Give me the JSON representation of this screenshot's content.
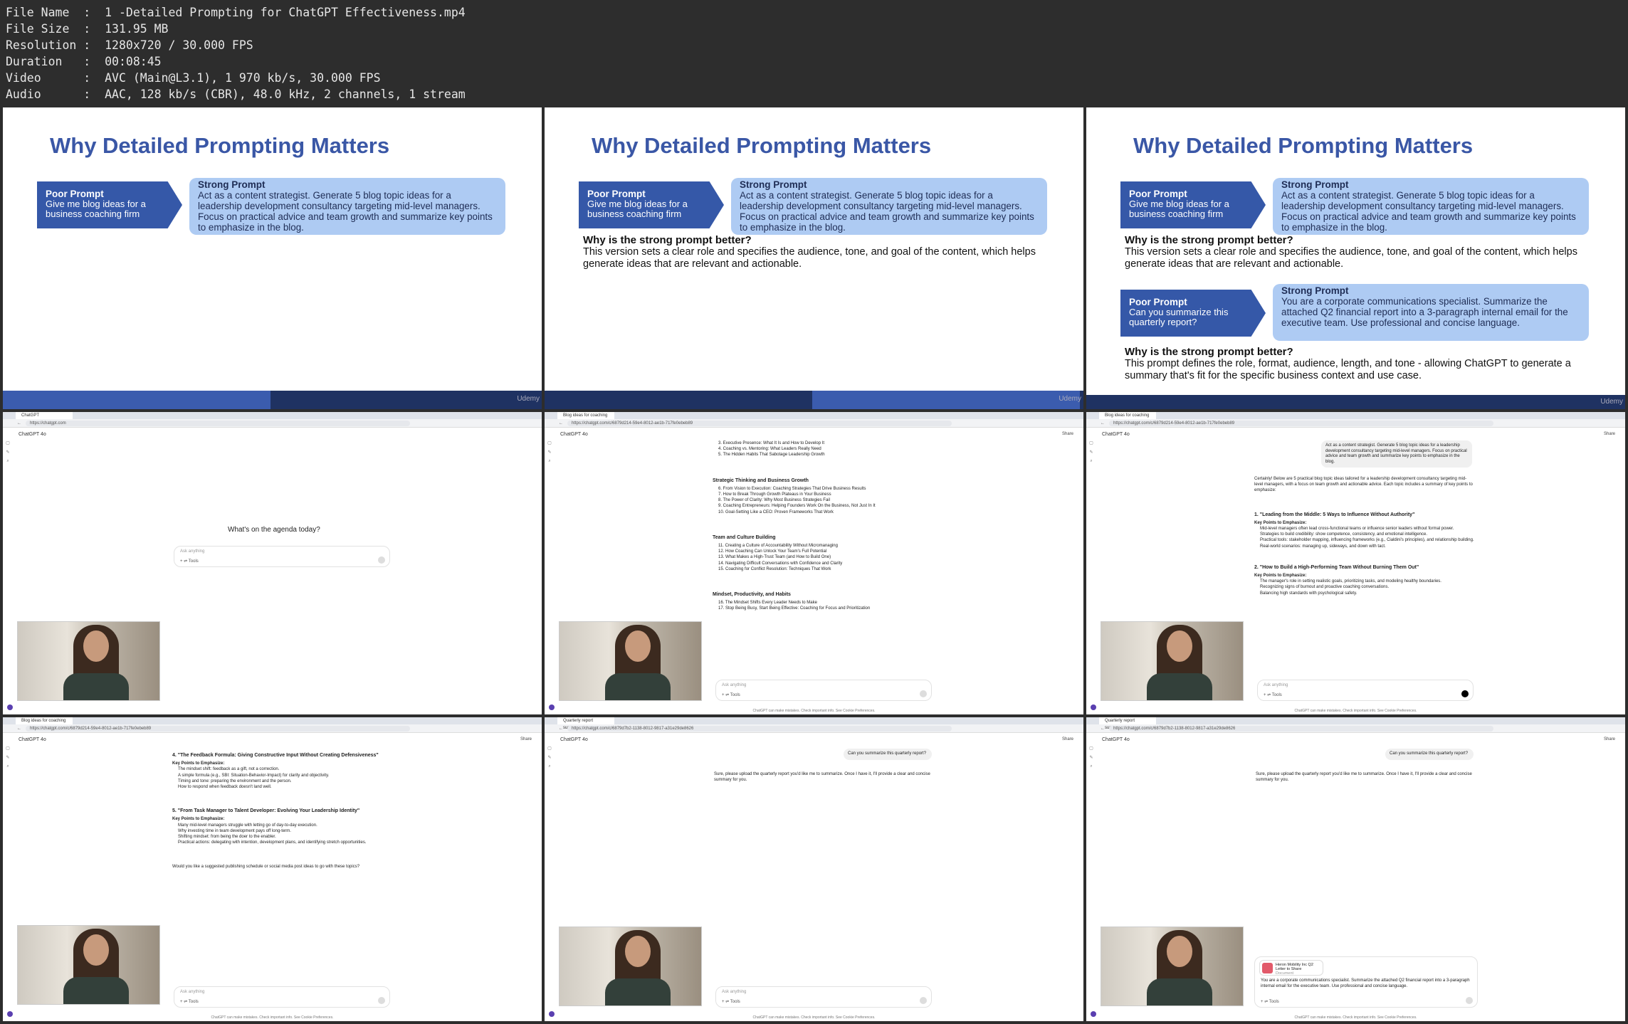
{
  "file_info": {
    "rows": [
      {
        "label": "File Name",
        "value": "1 -Detailed Prompting for ChatGPT Effectiveness.mp4"
      },
      {
        "label": "File Size",
        "value": "131.95 MB"
      },
      {
        "label": "Resolution",
        "value": "1280x720 / 30.000 FPS"
      },
      {
        "label": "Duration",
        "value": "00:08:45"
      },
      {
        "label": "Video",
        "value": "AVC (Main@L3.1), 1 970 kb/s, 30.000 FPS"
      },
      {
        "label": "Audio",
        "value": "AAC, 128 kb/s (CBR), 48.0 kHz, 2 channels, 1 stream"
      }
    ]
  },
  "slide": {
    "title": "Why Detailed Prompting Matters",
    "poor1_label": "Poor Prompt",
    "poor1_text": "Give me blog ideas for a business coaching firm",
    "strong1_label": "Strong Prompt",
    "strong1_text": "Act as a content strategist. Generate 5 blog topic ideas for a leadership development consultancy targeting mid-level managers. Focus on practical advice and team growth and summarize key points to emphasize in the blog.",
    "why1_q": "Why is the strong prompt better?",
    "why1_a": "This version sets a clear role and specifies the audience, tone, and goal of the content, which helps generate ideas that are relevant and actionable.",
    "poor2_label": "Poor Prompt",
    "poor2_text": "Can you summarize this quarterly report?",
    "strong2_label": "Strong Prompt",
    "strong2_text": "You are a corporate communications specialist. Summarize the attached Q2 financial report into a 3-paragraph internal email for the executive team. Use professional and concise language.",
    "why2_q": "Why is the strong prompt better?",
    "why2_a": "This prompt defines the role, format, audience, length, and tone - allowing ChatGPT to generate a summary that's fit for the specific business context and use case.",
    "logo": "Udemy"
  },
  "screens": {
    "gpt_label": "ChatGPT 4o",
    "share": "Share",
    "placeholder": "Ask anything",
    "tools": "Tools",
    "footer": "ChatGPT can make mistakes. Check important info. See Cookie Preferences.",
    "s1_tab": "ChatGPT",
    "s1_url": "https://chatgpt.com",
    "s1_heading": "What's on the agenda today?",
    "s2_tab": "Blog ideas for coaching",
    "s2_url": "https://chatgpt.com/c/6879d214-59e4-8012-ae1b-717fe0ebeb89",
    "s2_lines_top": [
      "3.  Executive Presence: What It Is and How to Develop It",
      "4.  Coaching vs. Mentoring: What Leaders Really Need",
      "5.  The Hidden Habits That Sabotage Leadership Growth"
    ],
    "s2_h1": "Strategic Thinking and Business Growth",
    "s2_l1": [
      "6.  From Vision to Execution: Coaching Strategies That Drive Business Results",
      "7.  How to Break Through Growth Plateaus in Your Business",
      "8.  The Power of Clarity: Why Most Business Strategies Fail",
      "9.  Coaching Entrepreneurs: Helping Founders Work On the Business, Not Just In It",
      "10.  Goal-Setting Like a CEO: Proven Frameworks That Work"
    ],
    "s2_h2": "Team and Culture Building",
    "s2_l2": [
      "11.  Creating a Culture of Accountability Without Micromanaging",
      "12.  How Coaching Can Unlock Your Team's Full Potential",
      "13.  What Makes a High-Trust Team (and How to Build One)",
      "14.  Navigating Difficult Conversations with Confidence and Clarity",
      "15.  Coaching for Conflict Resolution: Techniques That Work"
    ],
    "s2_h3": "Mindset, Productivity, and Habits",
    "s2_l3": [
      "16.  The Mindset Shifts Every Leader Needs to Make",
      "17.  Stop Being Busy, Start Being Effective: Coaching for Focus and Prioritization"
    ],
    "s3_user": "Act as a content strategist. Generate 5 blog topic ideas for a leadership development consultancy targeting mid-level managers. Focus on practical advice and team growth and summarize key points to emphasize in the blog.",
    "s3_intro": "Certainly! Below are 5 practical blog topic ideas tailored for a leadership development consultancy targeting mid-level managers, with a focus on team growth and actionable advice. Each topic includes a summary of key points to emphasize:",
    "s3_h1": "1. \"Leading from the Middle: 5 Ways to Influence Without Authority\"",
    "s3_kp": "Key Points to Emphasize:",
    "s3_b1": [
      "Mid-level managers often lead cross-functional teams or influence senior leaders without formal power.",
      "Strategies to build credibility: show competence, consistency, and emotional intelligence.",
      "Practical tools: stakeholder mapping, influencing frameworks (e.g., Cialdini's principles), and relationship building.",
      "Real-world scenarios: managing up, sideways, and down with tact."
    ],
    "s3_h2": "2. \"How to Build a High-Performing Team Without Burning Them Out\"",
    "s3_b2": [
      "The manager's role in setting realistic goals, prioritizing tasks, and modeling healthy boundaries.",
      "Recognizing signs of burnout and proactive coaching conversations.",
      "Balancing high standards with psychological safety."
    ],
    "s4_h1": "4. \"The Feedback Formula: Giving Constructive Input Without Creating Defensiveness\"",
    "s4_b1": [
      "The mindset shift: feedback as a gift, not a correction.",
      "A simple formula (e.g., SBI: Situation-Behavior-Impact) for clarity and objectivity.",
      "Timing and tone: preparing the environment and the person.",
      "How to respond when feedback doesn't land well."
    ],
    "s4_h2": "5. \"From Task Manager to Talent Developer: Evolving Your Leadership Identity\"",
    "s4_b2": [
      "Many mid-level managers struggle with letting go of day-to-day execution.",
      "Why investing time in team development pays off long-term.",
      "Shifting mindset: from being the doer to the enabler.",
      "Practical actions: delegating with intention, development plans, and identifying stretch opportunities."
    ],
    "s4_q": "Would you like a suggested publishing schedule or social media post ideas to go with these topics?",
    "s5_tab": "Quarterly report summary",
    "s5_url": "https://chatgpt.com/c/6879d7b2-1138-8012-9817-a31e29de8626",
    "s5_user": "Can you summarize this quarterly report?",
    "s5_reply": "Sure, please upload the quarterly report you'd like me to summarize. Once I have it, I'll provide a clear and concise summary for you.",
    "s6_file": "Heron Mobility Inc Q2 Letter to Share",
    "s6_file_type": "Document",
    "s6_draft": "You are a corporate communications specialist. Summarize the attached Q2 financial report into a 3-paragraph internal email for the executive team. Use professional and concise language."
  }
}
